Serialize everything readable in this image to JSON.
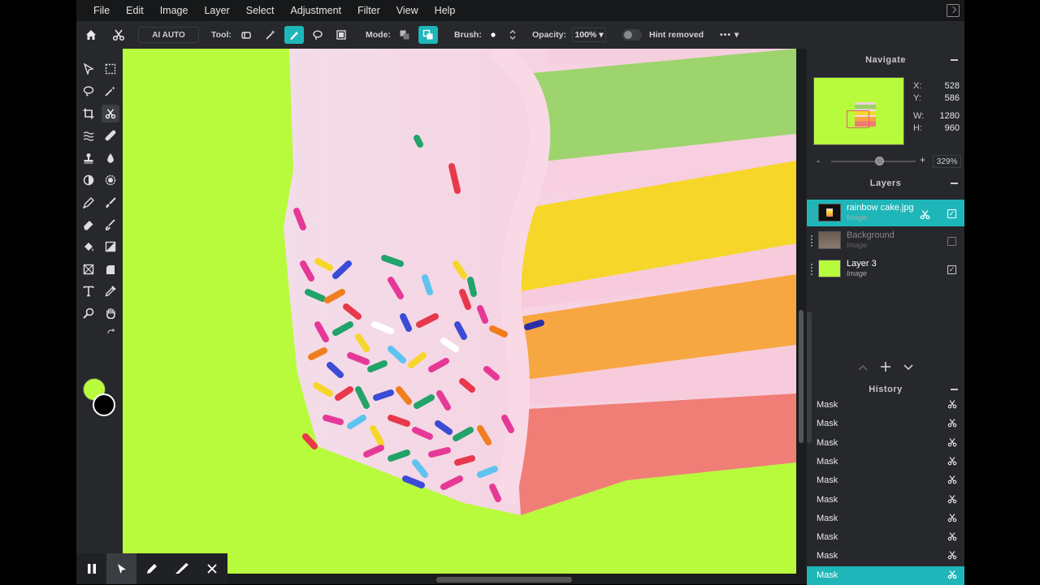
{
  "menu": [
    "File",
    "Edit",
    "Image",
    "Layer",
    "Select",
    "Adjustment",
    "Filter",
    "View",
    "Help"
  ],
  "toolbar": {
    "ai_label": "AI AUTO",
    "tool_label": "Tool:",
    "mode_label": "Mode:",
    "brush_label": "Brush:",
    "opacity_label": "Opacity:",
    "opacity_value": "100%",
    "hint_label": "Hint removed",
    "more": "•••"
  },
  "colors": {
    "foreground": "#b8fb3c",
    "background": "#000000",
    "accent": "#1fb6b9"
  },
  "navigate": {
    "title": "Navigate",
    "x_label": "X:",
    "x_value": "528",
    "y_label": "Y:",
    "y_value": "586",
    "w_label": "W:",
    "w_value": "1280",
    "h_label": "H:",
    "h_value": "960",
    "zoom_minus": "-",
    "zoom_plus": "+",
    "zoom_value": "329%"
  },
  "layers": {
    "title": "Layers",
    "items": [
      {
        "name": "rainbow cake.jpg",
        "type": "Image"
      },
      {
        "name": "Background",
        "type": "Image"
      },
      {
        "name": "Layer 3",
        "type": "Image"
      }
    ]
  },
  "history": {
    "title": "History",
    "items": [
      "Mask",
      "Mask",
      "Mask",
      "Mask",
      "Mask",
      "Mask",
      "Mask",
      "Mask",
      "Mask",
      "Mask"
    ]
  }
}
